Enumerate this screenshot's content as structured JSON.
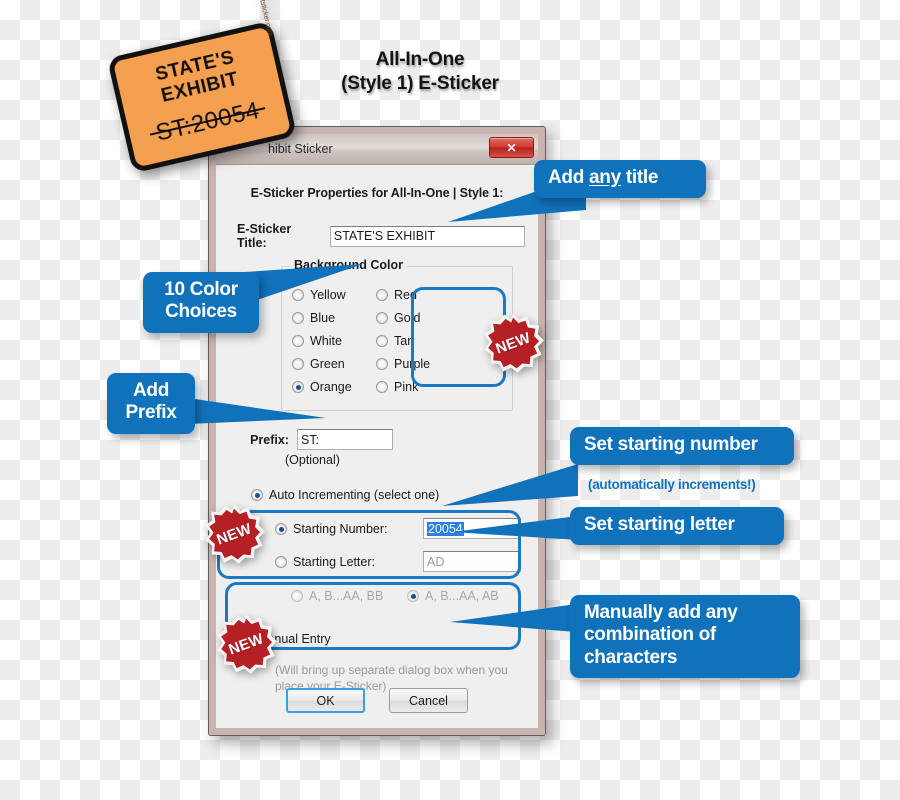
{
  "heading": {
    "line1": "All-In-One",
    "line2": "(Style 1) E-Sticker"
  },
  "sticker": {
    "line1": "STATE'S",
    "line2": "EXHIBIT",
    "number": "ST:20054",
    "side_text": "exhibitsticker.com"
  },
  "dialog": {
    "title": "hibit Sticker",
    "close_label": "✕",
    "properties_heading": "E-Sticker Properties for All-In-One | Style 1:",
    "title_field": {
      "label": "E-Sticker Title:",
      "value": "STATE'S EXHIBIT"
    },
    "background_color": {
      "legend": "Background Color",
      "column1": [
        {
          "label": "Yellow",
          "checked": false
        },
        {
          "label": "Blue",
          "checked": false
        },
        {
          "label": "White",
          "checked": false
        },
        {
          "label": "Green",
          "checked": false
        },
        {
          "label": "Orange",
          "checked": true
        }
      ],
      "column2": [
        {
          "label": "Red",
          "checked": false
        },
        {
          "label": "Gold",
          "checked": false
        },
        {
          "label": "Tan",
          "checked": false
        },
        {
          "label": "Purple",
          "checked": false
        },
        {
          "label": "Pink",
          "checked": false
        }
      ]
    },
    "prefix": {
      "label": "Prefix:",
      "value": "ST:",
      "optional_note": "(Optional)"
    },
    "auto_incrementing": {
      "label": "Auto Incrementing (select one)",
      "checked": true
    },
    "starting_number": {
      "label": "Starting Number:",
      "value": "20054",
      "checked": true,
      "selected": true
    },
    "starting_letter": {
      "label": "Starting Letter:",
      "placeholder": "AD",
      "checked": false,
      "options": [
        {
          "label": "A, B...AA, BB",
          "checked": false
        },
        {
          "label": "A, B...AA, AB",
          "checked": true
        }
      ]
    },
    "manual_entry": {
      "label": "Manual Entry",
      "checked": false,
      "note": "(Will bring up separate dialog box when you place your E-Sticker)"
    },
    "buttons": {
      "ok": "OK",
      "cancel": "Cancel"
    }
  },
  "callouts": {
    "add_title": "Add any title",
    "add_title_pre": "Add ",
    "add_title_em": "any",
    "add_title_post": " title",
    "color_choices_l1": "10 Color",
    "color_choices_l2": "Choices",
    "add_prefix_l1": "Add",
    "add_prefix_l2": "Prefix",
    "set_starting_number": "Set starting number",
    "auto_increments_note": "(automatically increments!)",
    "set_starting_letter": "Set starting letter",
    "manual_l1": "Manually add any",
    "manual_l2": "combination of",
    "manual_l3": "characters"
  },
  "badges": {
    "new": "NEW"
  },
  "colors": {
    "callout_blue": "#1072bb",
    "highlight_blue": "#1a7ac4",
    "badge_red": "#b52025",
    "sticker_orange": "#f5a051",
    "selection_blue": "#2b7fe0"
  }
}
